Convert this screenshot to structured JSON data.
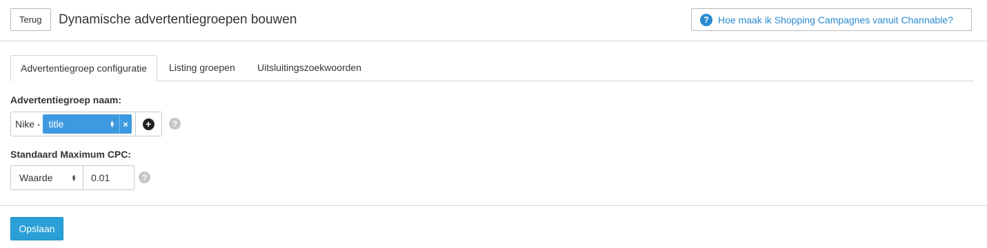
{
  "header": {
    "back_label": "Terug",
    "title": "Dynamische advertentiegroepen bouwen",
    "help_label": "Hoe maak ik Shopping Campagnes vanuit Channable?",
    "help_icon": "question-circle-icon",
    "accent_color": "#2a8ad0"
  },
  "tabs": [
    {
      "label": "Advertentiegroep configuratie",
      "active": true
    },
    {
      "label": "Listing groepen",
      "active": false
    },
    {
      "label": "Uitsluitingszoekwoorden",
      "active": false
    }
  ],
  "ad_group_name": {
    "label": "Advertentiegroep naam:",
    "prefix": "Nike -",
    "token_value": "title",
    "token_color": "#3d9ae0",
    "remove_icon": "×",
    "add_icon": "+",
    "help_icon": "?"
  },
  "max_cpc": {
    "label": "Standaard Maximum CPC:",
    "type_value": "Waarde",
    "amount_value": "0.01",
    "help_icon": "?"
  },
  "footer": {
    "save_label": "Opslaan",
    "save_color": "#2a9fd8"
  }
}
